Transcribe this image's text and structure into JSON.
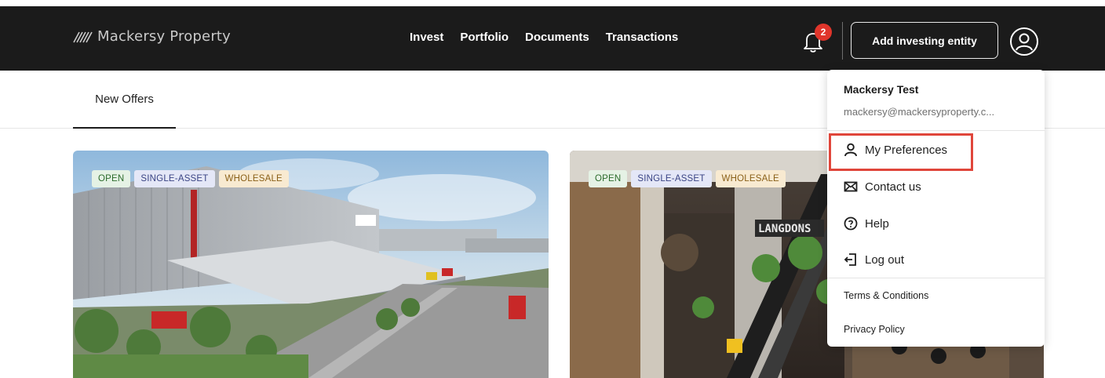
{
  "header": {
    "brand": "Mackersy Property",
    "nav": [
      "Invest",
      "Portfolio",
      "Documents",
      "Transactions"
    ],
    "notification_count": "2",
    "add_entity_label": "Add investing entity"
  },
  "tabs": {
    "active": "New Offers"
  },
  "cards": [
    {
      "tags": [
        "OPEN",
        "SINGLE-ASSET",
        "WHOLESALE"
      ]
    },
    {
      "tags": [
        "OPEN",
        "SINGLE-ASSET",
        "WHOLESALE"
      ],
      "signage": "LANGDONS"
    }
  ],
  "profile_menu": {
    "name": "Mackersy Test",
    "email": "mackersy@mackersyproperty.c...",
    "items": [
      {
        "label": "My Preferences",
        "icon": "person-icon",
        "highlighted": true
      },
      {
        "label": "Contact us",
        "icon": "mail-icon"
      },
      {
        "label": "Help",
        "icon": "help-icon"
      },
      {
        "label": "Log out",
        "icon": "logout-icon"
      }
    ],
    "links": [
      "Terms & Conditions",
      "Privacy Policy"
    ]
  },
  "colors": {
    "topbar": "#1b1b1b",
    "badge": "#e0352b",
    "highlight_border": "#e0463b"
  }
}
